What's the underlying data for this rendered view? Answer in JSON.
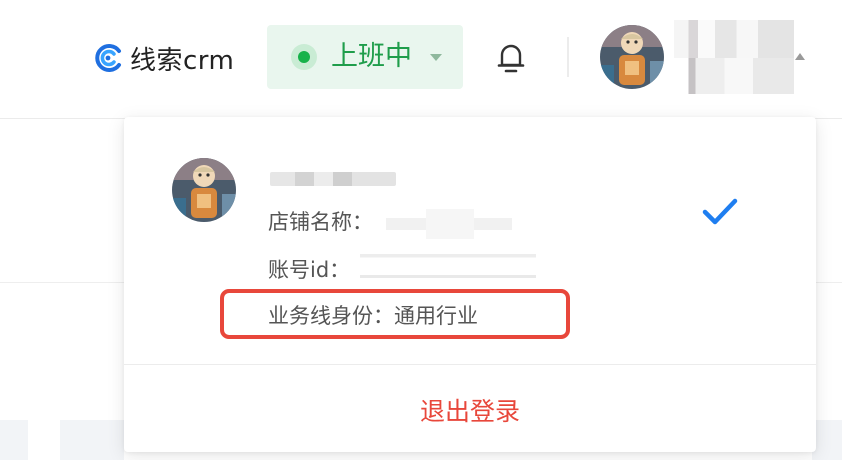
{
  "header": {
    "brand_name": "线索crm",
    "brand_icon": "crm-logo-icon",
    "status_label": "上班中",
    "status_color": "#16b24a",
    "bell_icon": "bell-icon"
  },
  "account_menu": {
    "shop_label": "店铺名称：",
    "account_id_label": "账号id：",
    "business_line_label": "业务线身份：通用行业",
    "selected_icon": "check-icon",
    "logout_label": "退出登录"
  },
  "colors": {
    "accent_blue": "#1f7ef0",
    "status_green": "#1f9d4b",
    "danger_red": "#e8473b"
  }
}
